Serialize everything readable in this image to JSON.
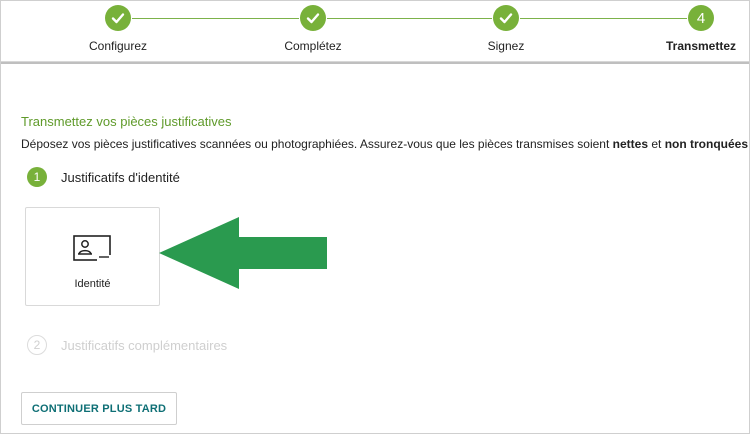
{
  "stepper": {
    "steps": [
      {
        "label": "Configurez",
        "state": "done",
        "icon": "check-icon"
      },
      {
        "label": "Complétez",
        "state": "done",
        "icon": "check-icon"
      },
      {
        "label": "Signez",
        "state": "done",
        "icon": "check-icon"
      },
      {
        "label": "Transmettez",
        "state": "current",
        "number": "4"
      }
    ],
    "accent": "#78b13a"
  },
  "section": {
    "title": "Transmettez vos pièces justificatives",
    "desc_prefix": "Déposez vos pièces justificatives scannées ou photographiées. Assurez-vous que les pièces transmises soient ",
    "desc_bold1": "nettes",
    "desc_mid": " et ",
    "desc_bold2": "non tronquées",
    "desc_suffix": " ."
  },
  "substeps": [
    {
      "number": "1",
      "label": "Justificatifs d'identité",
      "state": "active"
    },
    {
      "number": "2",
      "label": "Justificatifs complémentaires",
      "state": "inactive"
    }
  ],
  "doc_card": {
    "label": "Identité",
    "icon": "id-card-icon"
  },
  "annotation": {
    "icon": "arrow-left-icon",
    "color": "#2a9a4f"
  },
  "button": {
    "label": "CONTINUER PLUS TARD",
    "color": "#0e6f75"
  }
}
